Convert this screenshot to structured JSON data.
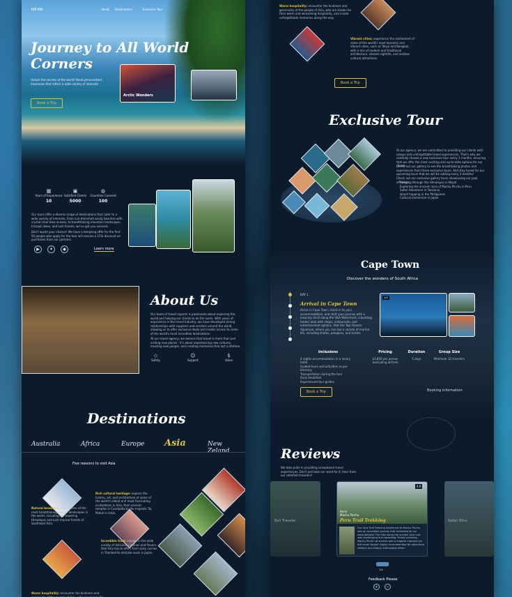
{
  "brand": "FLY FLY",
  "nav": {
    "items": [
      "About",
      "Destinations",
      "Exclusive Tour"
    ]
  },
  "hero": {
    "title_line1": "Journey to All World",
    "title_line2": "Corners",
    "subtitle": "Unlock the secrets of the world! Book personalized itineraries that reflect a wide variety of interests",
    "cta": "Book a Trip",
    "card_title": "Arctic Wonders"
  },
  "stats": [
    {
      "label": "Years of Experience",
      "value": "10"
    },
    {
      "label": "Satisfied Clients",
      "value": "5000"
    },
    {
      "label": "Countries Covered",
      "value": "100"
    }
  ],
  "intro": {
    "text": "Our tours offer a diverse range of destinations that cater to a wide variety of interests. From sun-drenched sandy beaches with crystal-clear blue oceans, to breathtaking mountain landscapes, tranquil lakes, and lush forests, we've got you covered.",
    "text2": "Don't waste your chance! We have a tempting offer for the first 50 people who apply for the tour will receive a 15% discount on purchases from our partners.",
    "learn_more": "Learn more"
  },
  "about": {
    "title": "About Us",
    "text": "Our team of travel experts is passionate about exploring the world and helping our clients to do the same. With years of experience in the travel industry, we have developed strong relationships with suppliers and vendors around the world, allowing us to offer exclusive deals and insider access to some of the world's most incredible destinations.",
    "text2": "At our travel agency, we believe that travel is more than just visiting new places - it's about experiencing new cultures, meeting new people, and creating memories that last a lifetime.",
    "features": [
      "Safety",
      "Support",
      "Value"
    ]
  },
  "destinations": {
    "title": "Destinations",
    "tabs": [
      "Australia",
      "Africa",
      "Europe",
      "Asia",
      "New Zeland"
    ],
    "active": "Asia",
    "reasons_title": "Five reasons to visit Asia",
    "reasons": [
      {
        "title": "Rich cultural heritage:",
        "text": "explore the history, art, and architecture of some of the world's oldest and most fascinating civilizations in Asia, from ancient temples in Cambodia to the majestic Taj Mahal in India."
      },
      {
        "title": "Natural beauty:",
        "text": "discover some of the most breathtaking natural landscapes in the world, including the towering Himalayas and lush tropical forests of Southeast Asia."
      },
      {
        "title": "Incredible food:",
        "text": "indulge in the wide variety of delicious cuisines and flavors that Asia has to offer, from spicy curries in Thailand to delicate sushi in Japan."
      },
      {
        "title": "Warm hospitality:",
        "text": "encounter the kindness and generosity of the people of Asia, who are known for their warm and welcoming hospitality, and create unforgettable memories along the way."
      },
      {
        "title": "Vibrant cities:",
        "text": "experience the excitement of some of the world's most dynamic and vibrant cities, such as Tokyo and Bangkok, with a mix of modern and traditional architecture, vibrant nightlife, and endless cultural attractions."
      }
    ],
    "cta": "Book a Trip"
  },
  "exclusive": {
    "title": "Exclusive Tour",
    "text": "At our agency, we are committed to providing our clients with unique and unforgettable travel experiences. That's why we carefully choose a new exclusive tour every 3 months, ensuring that we offer the most exciting and up-to-date options for our clients.",
    "text2": "Check out our gallery to see the breathtaking photos and experiences from these exclusive tours. And stay tuned for our upcoming tours that we will be adding every 3 months!",
    "text3": "Check out our exclusive gallery tours showcasing our past offerings:",
    "tours": [
      "Trekking through the Himalayas in Nepal",
      "Exploring the ancient ruins of Machu Picchu in Peru",
      "Safari Adventure in Tanzania",
      "Island hopping in the Philippines",
      "Cultural immersion in Japan"
    ]
  },
  "cape": {
    "title": "Cape Town",
    "subtitle": "Discover the wonders of South Africa",
    "day": "DAY 1",
    "day_title": "Arrival in Cape Town",
    "day_text": "Arrive in Cape Town, check in to your accommodation, and start your journey with a leisurely stroll along the V&A Waterfront, a bustling harbor area with shops, restaurants, and entertainment options. Visit the Two Oceans Aquarium, where you can see a variety of marine life, including sharks, penguins, and turtles.",
    "slide": "1/3",
    "inclusions_title": "Inclusions",
    "inclusions": [
      "4 nights accommodation in a luxury hotel",
      "Guided tours and activities as per itinerary",
      "Transportation during the tour",
      "Daily breakfast",
      "Experienced tour guides"
    ],
    "pricing_title": "Pricing",
    "pricing": "$3,850 per person (excluding airfare)",
    "duration_title": "Duration",
    "duration": "5 days",
    "group_title": "Group Size",
    "group": "Minimum 12 travelers",
    "cta": "Book a Trip",
    "booking": "Booking information"
  },
  "reviews": {
    "title": "Reviews",
    "text": "We take pride in providing exceptional travel experiences. Don't just take our word for it, hear from our satisfied travelers!",
    "badge": "4.9",
    "name": "Anna",
    "location": "Machu Picchu",
    "tag": "Peru Trail Trekking",
    "quote": "Our Inca Trail Trekking Adventure to Machu Picchu was an incredible journey that exceeded all our expectations! The hike along the ancient Inca trail was challenging but rewarding. Finally reaching Machu Picchu at sunrise was a magical moment we will never forget! Highly recommended for adventure seekers and history enthusiasts alike!",
    "side_left_label": "Bali Traveler",
    "side_right_label": "Safari Bliss",
    "page": "1/4",
    "feedback": "Feedback Please"
  },
  "colors": {
    "accent": "#e2c23a",
    "panel": "#0c1b2c",
    "text": "#e8eef6"
  }
}
